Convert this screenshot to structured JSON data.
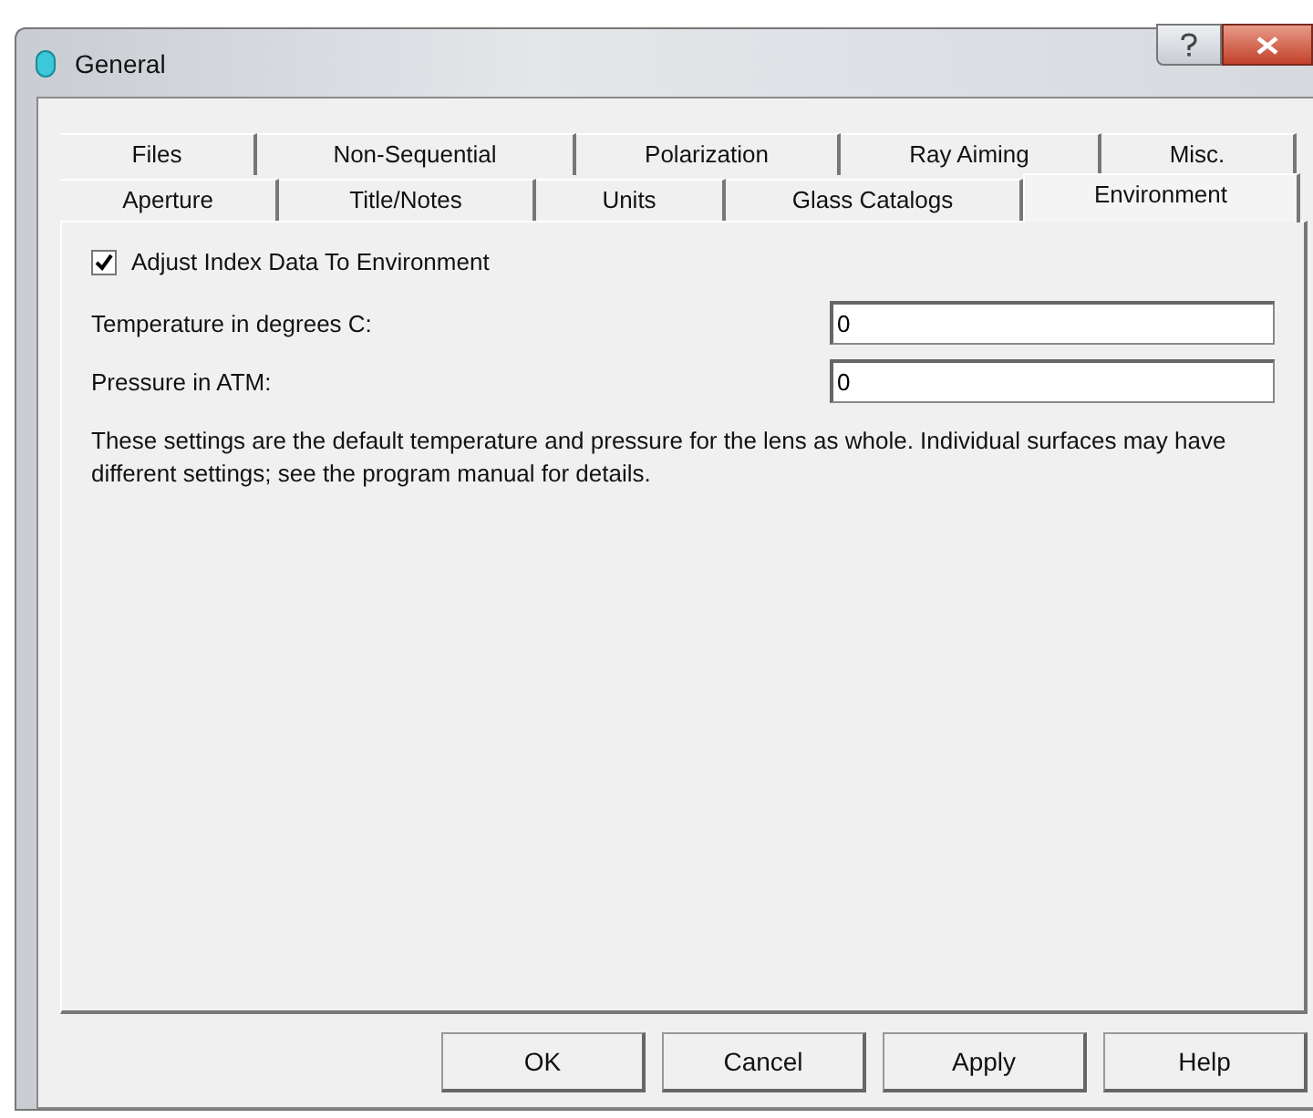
{
  "window": {
    "title": "General"
  },
  "tab_rows": [
    [
      {
        "label": "Files",
        "selected": false
      },
      {
        "label": "Non-Sequential",
        "selected": false
      },
      {
        "label": "Polarization",
        "selected": false
      },
      {
        "label": "Ray Aiming",
        "selected": false
      },
      {
        "label": "Misc.",
        "selected": false
      }
    ],
    [
      {
        "label": "Aperture",
        "selected": false
      },
      {
        "label": "Title/Notes",
        "selected": false
      },
      {
        "label": "Units",
        "selected": false
      },
      {
        "label": "Glass Catalogs",
        "selected": false
      },
      {
        "label": "Environment",
        "selected": true
      }
    ]
  ],
  "checkbox": {
    "label": "Adjust Index Data To Environment",
    "checked": true
  },
  "fields": [
    {
      "label": "Temperature in degrees C:",
      "value": "0"
    },
    {
      "label": "Pressure in ATM:",
      "value": "0"
    }
  ],
  "note": "These settings are the default temperature and pressure for the lens as whole. Individual surfaces may have different settings; see the program manual for details.",
  "buttons": [
    "OK",
    "Cancel",
    "Apply",
    "Help"
  ]
}
